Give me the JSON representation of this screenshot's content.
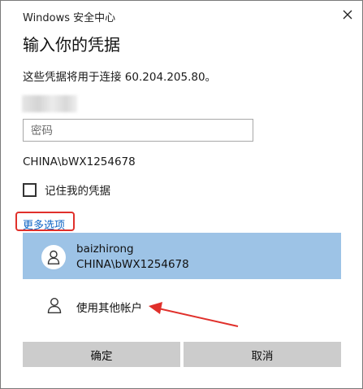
{
  "window": {
    "app_title": "Windows 安全中心"
  },
  "heading": "输入你的凭据",
  "subtitle": "这些凭据将用于连接 60.204.205.80。",
  "password": {
    "placeholder": "密码",
    "value": ""
  },
  "domain_label": "CHINA\\bWX1254678",
  "remember": {
    "label": "记住我的凭据",
    "checked": false
  },
  "more_options": "更多选项",
  "accounts": [
    {
      "name": "baizhirong",
      "sub": "CHINA\\bWX1254678",
      "selected": true
    },
    {
      "name": "使用其他帐户",
      "selected": false
    }
  ],
  "buttons": {
    "ok": "确定",
    "cancel": "取消"
  },
  "colors": {
    "selected_bg": "#9dc3e6",
    "button_bg": "#cccccc",
    "link": "#0b63c4",
    "annotation": "#e0302b"
  },
  "icons": {
    "close": "close-icon",
    "user": "user-icon"
  }
}
